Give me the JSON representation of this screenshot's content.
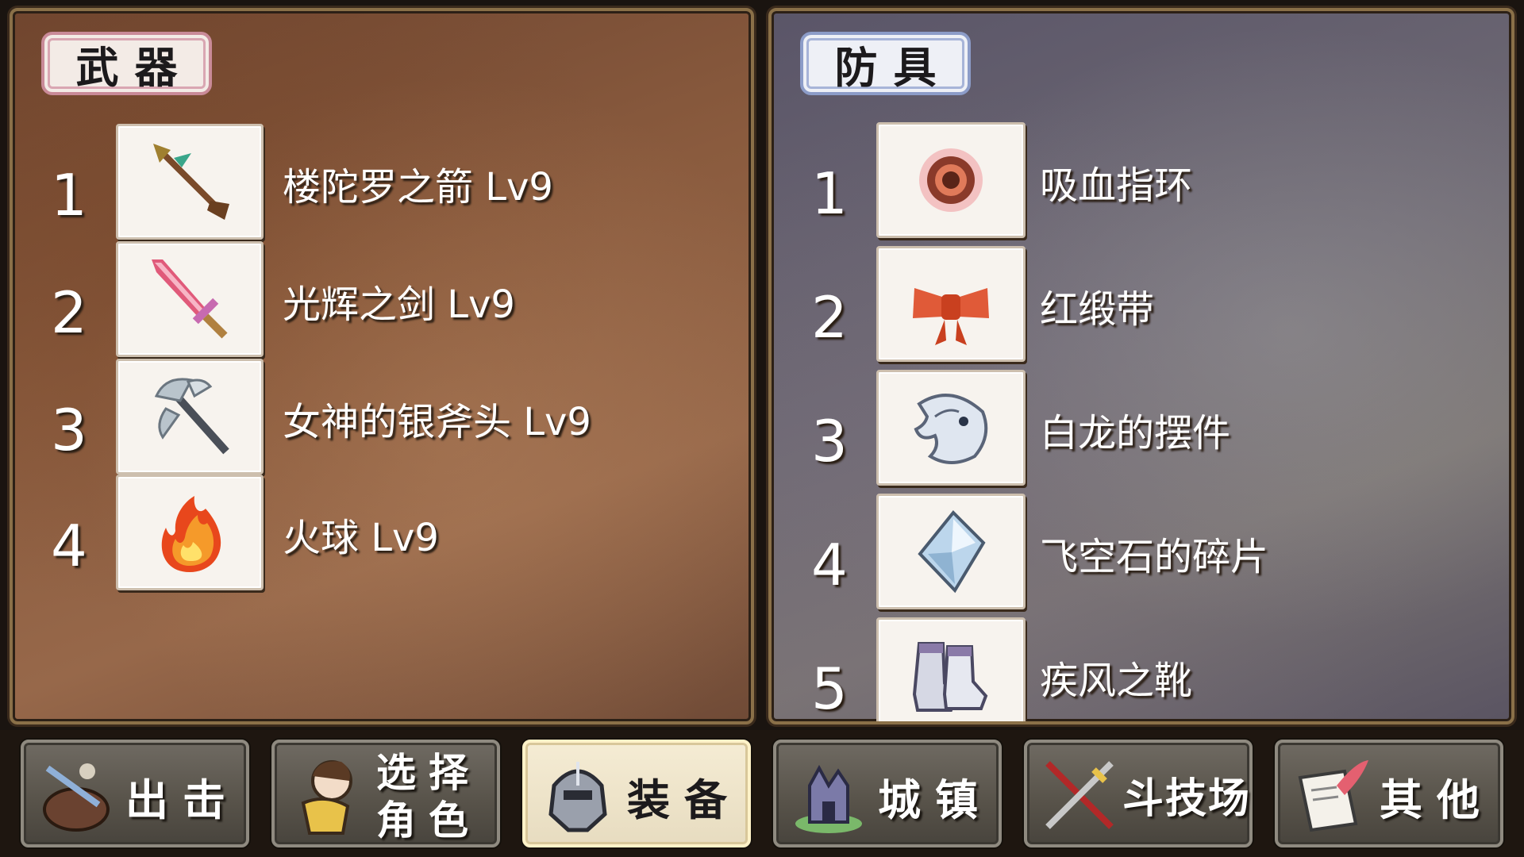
{
  "weapons_panel": {
    "title": "武器",
    "items": [
      {
        "number": "1",
        "name": "楼陀罗之箭 Lv9",
        "icon": "arrow-icon"
      },
      {
        "number": "2",
        "name": "光辉之剑 Lv9",
        "icon": "pink-sword-icon"
      },
      {
        "number": "3",
        "name": "女神的银斧头 Lv9",
        "icon": "silver-axe-icon"
      },
      {
        "number": "4",
        "name": "火球 Lv9",
        "icon": "fireball-icon"
      }
    ]
  },
  "armor_panel": {
    "title": "防具",
    "items": [
      {
        "number": "1",
        "name": "吸血指环",
        "icon": "ring-icon"
      },
      {
        "number": "2",
        "name": "红缎带",
        "icon": "red-ribbon-icon"
      },
      {
        "number": "3",
        "name": "白龙的摆件",
        "icon": "white-dragon-icon"
      },
      {
        "number": "4",
        "name": "飞空石的碎片",
        "icon": "crystal-shard-icon"
      },
      {
        "number": "5",
        "name": "疾风之靴",
        "icon": "boots-icon"
      }
    ]
  },
  "nav": {
    "sortie": "出击",
    "select_line1": "选择",
    "select_line2": "角色",
    "equip": "装备",
    "town": "城镇",
    "arena": "斗技场",
    "other": "其他",
    "active": "equip"
  },
  "colors": {
    "weapons_bg": "#8a5b3e",
    "armor_bg": "#6f6a74",
    "weapons_title_border": "#c98a98",
    "armor_title_border": "#8c9cc8"
  }
}
